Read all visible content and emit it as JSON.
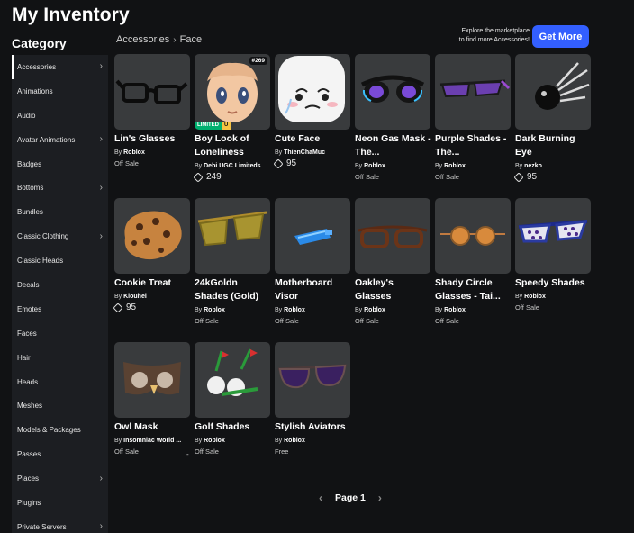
{
  "page": {
    "title": "My Inventory"
  },
  "sidebar": {
    "heading": "Category",
    "items": [
      {
        "label": "Accessories",
        "chevron": true,
        "active": true
      },
      {
        "label": "Animations",
        "chevron": false
      },
      {
        "label": "Audio",
        "chevron": false
      },
      {
        "label": "Avatar Animations",
        "chevron": true
      },
      {
        "label": "Badges",
        "chevron": false
      },
      {
        "label": "Bottoms",
        "chevron": true
      },
      {
        "label": "Bundles",
        "chevron": false
      },
      {
        "label": "Classic Clothing",
        "chevron": true
      },
      {
        "label": "Classic Heads",
        "chevron": false
      },
      {
        "label": "Decals",
        "chevron": false
      },
      {
        "label": "Emotes",
        "chevron": false
      },
      {
        "label": "Faces",
        "chevron": false
      },
      {
        "label": "Hair",
        "chevron": false
      },
      {
        "label": "Heads",
        "chevron": false
      },
      {
        "label": "Meshes",
        "chevron": false
      },
      {
        "label": "Models & Packages",
        "chevron": false
      },
      {
        "label": "Passes",
        "chevron": false
      },
      {
        "label": "Places",
        "chevron": true
      },
      {
        "label": "Plugins",
        "chevron": false
      },
      {
        "label": "Private Servers",
        "chevron": true
      }
    ]
  },
  "breadcrumb": {
    "parent": "Accessories",
    "separator": "›",
    "current": "Face"
  },
  "promo": {
    "line1": "Explore the marketplace",
    "line2": "to find more Accessories!",
    "button": "Get More"
  },
  "items": [
    {
      "name": "Lin's Glasses",
      "by": "By",
      "creator": "Roblox",
      "price": "Off Sale",
      "robux": false,
      "icon": "glasses-icon"
    },
    {
      "name": "Boy Look of Loneliness",
      "by": "By",
      "creator": "Debi UGC Limiteds",
      "price": "249",
      "robux": true,
      "icon": "anime-head-icon",
      "badge": "#269",
      "limited": "LIMITED",
      "limited_u": "U"
    },
    {
      "name": "Cute Face",
      "by": "By",
      "creator": "ThienChaMuc",
      "price": "95",
      "robux": true,
      "icon": "cute-face-icon"
    },
    {
      "name": "Neon Gas Mask - The...",
      "by": "By",
      "creator": "Roblox",
      "price": "Off Sale",
      "robux": false,
      "icon": "gas-mask-icon"
    },
    {
      "name": "Purple Shades - The...",
      "by": "By",
      "creator": "Roblox",
      "price": "Off Sale",
      "robux": false,
      "icon": "purple-shades-icon"
    },
    {
      "name": "Dark Burning Eye",
      "by": "By",
      "creator": "nezko",
      "price": "95",
      "robux": true,
      "icon": "burning-eye-icon"
    },
    {
      "name": "Cookie Treat",
      "by": "By",
      "creator": "Kiouhei",
      "price": "95",
      "robux": true,
      "icon": "cookie-icon"
    },
    {
      "name": "24kGoldn Shades (Gold)",
      "by": "By",
      "creator": "Roblox",
      "price": "Off Sale",
      "robux": false,
      "icon": "gold-shades-icon"
    },
    {
      "name": "Motherboard Visor",
      "by": "By",
      "creator": "Roblox",
      "price": "Off Sale",
      "robux": false,
      "icon": "visor-icon"
    },
    {
      "name": "Oakley's Glasses",
      "by": "By",
      "creator": "Roblox",
      "price": "Off Sale",
      "robux": false,
      "icon": "brown-glasses-icon"
    },
    {
      "name": "Shady Circle Glasses - Tai...",
      "by": "By",
      "creator": "Roblox",
      "price": "Off Sale",
      "robux": false,
      "icon": "circle-glasses-icon"
    },
    {
      "name": "Speedy Shades",
      "by": "By",
      "creator": "Roblox",
      "price": "Off Sale",
      "robux": false,
      "icon": "speedy-shades-icon"
    },
    {
      "name": "Owl Mask",
      "by": "By",
      "creator": "Insomniac World ...",
      "price": "Off Sale",
      "robux": false,
      "icon": "owl-mask-icon"
    },
    {
      "name": "Golf Shades",
      "by": "By",
      "creator": "Roblox",
      "price": "Off Sale",
      "robux": false,
      "icon": "golf-shades-icon"
    },
    {
      "name": "Stylish Aviators",
      "by": "By",
      "creator": "Roblox",
      "price": "Free",
      "robux": false,
      "icon": "aviators-icon"
    }
  ],
  "stray_mark": "-",
  "pagination": {
    "label": "Page 1",
    "prev": "‹",
    "next": "›"
  },
  "colors": {
    "background": "#111214",
    "sidebar": "#1c1e22",
    "tile": "#393b3d",
    "accent": "#335fff"
  }
}
